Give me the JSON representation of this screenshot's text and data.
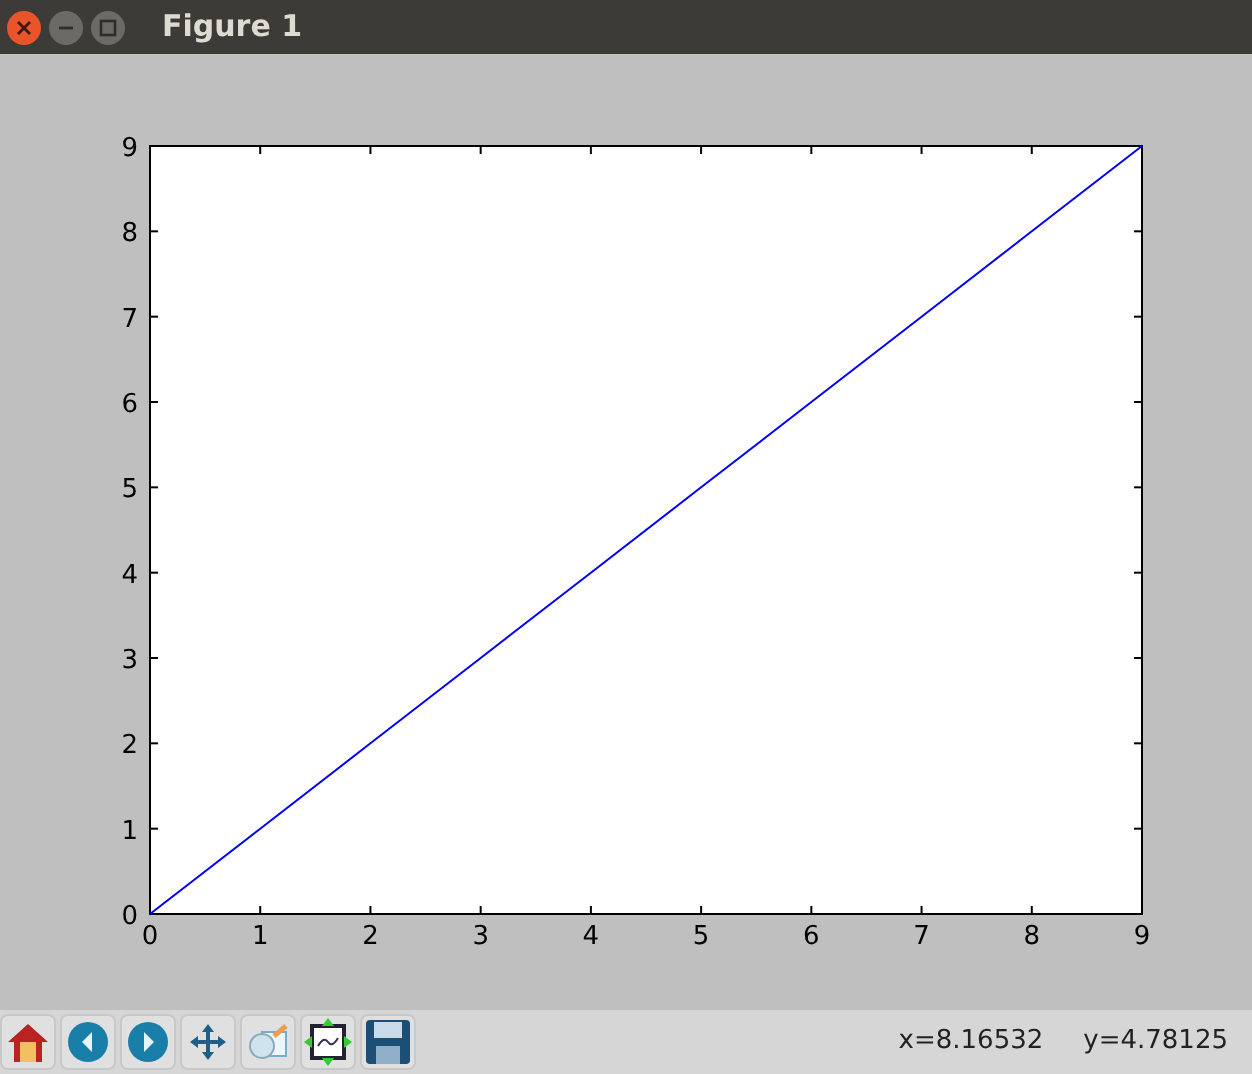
{
  "window": {
    "title": "Figure 1"
  },
  "chart_data": {
    "type": "line",
    "x": [
      0,
      1,
      2,
      3,
      4,
      5,
      6,
      7,
      8,
      9
    ],
    "series": [
      {
        "color": "#0000ff",
        "values": [
          0,
          1,
          2,
          3,
          4,
          5,
          6,
          7,
          8,
          9
        ]
      }
    ],
    "xlim": [
      0,
      9
    ],
    "ylim": [
      0,
      9
    ],
    "xticks": [
      0,
      1,
      2,
      3,
      4,
      5,
      6,
      7,
      8,
      9
    ],
    "yticks": [
      0,
      1,
      2,
      3,
      4,
      5,
      6,
      7,
      8,
      9
    ]
  },
  "status": {
    "x_reading": "x=8.16532",
    "y_reading": "y=4.78125"
  }
}
